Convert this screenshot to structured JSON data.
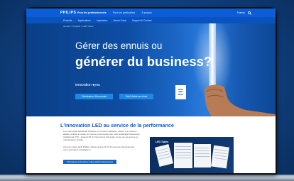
{
  "nav": {
    "logo": "PHILIPS",
    "primary": [
      "Pour les professionnels",
      "Pour les particuliers",
      "À propos"
    ],
    "country": "France",
    "secondary": [
      "Produits",
      "Applications",
      "Inspiration",
      "Savoir-Faire",
      "Support & Contact"
    ]
  },
  "breadcrumb": "Accueil > Produits > LED Tubes",
  "hero": {
    "line1": "Gérer des ennuis ou",
    "line2": "générer du business?",
    "tagline": "innovation",
    "tagline_suffix": "you",
    "button1": "Calculateur d'économie",
    "button2": "Outil d'aide au choix",
    "badge": [
      "REAL",
      "PRO",
      "DEAL"
    ]
  },
  "content": {
    "title": "L'innovation LED au service de la performance",
    "para1": "Les tubes LED MASTER LEDtube et CorePro LEDtube, offrent une solution idéale et facile à mettre en oeuvre pour transformer votre éclairage fluorescent traditionnel (T8) : Jusqu'à 60 % d'économie d'énergie, durée de vie accrue et maintenance réduite.",
    "para2": "Avec les tubes LED Philips, faites jusqu'à 70 % d'économie d'énergie dès votre premières installations.",
    "cta": "Télécharger la brochure Tubes LED professionnels",
    "promo_title": "LED Tubes"
  }
}
